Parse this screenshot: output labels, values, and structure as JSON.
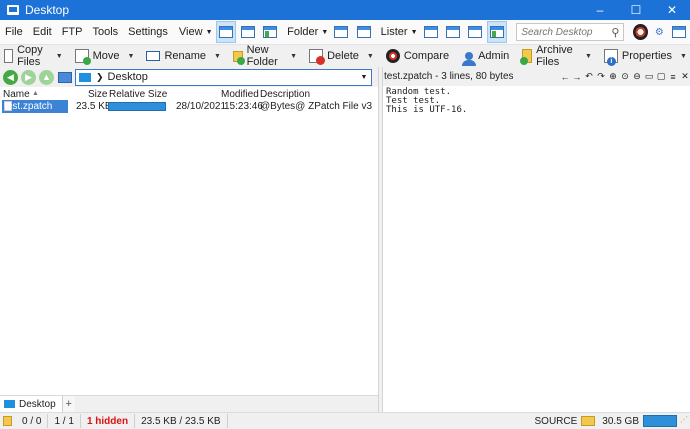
{
  "window": {
    "title": "Desktop",
    "minimize": "–",
    "maximize": "☐",
    "close": "✕"
  },
  "menu": [
    "File",
    "Edit",
    "FTP",
    "Tools",
    "Settings"
  ],
  "view_dropdown": "View",
  "folder_dropdown": "Folder",
  "lister_dropdown": "Lister",
  "search": {
    "placeholder": "Search Desktop"
  },
  "toolbar": {
    "copy": "Copy Files",
    "move": "Move",
    "rename": "Rename",
    "new_folder": "New Folder",
    "delete": "Delete",
    "compare": "Compare",
    "admin": "Admin",
    "archive": "Archive Files",
    "properties": "Properties"
  },
  "left_pane": {
    "path": "Desktop",
    "columns": {
      "name": "Name",
      "size": "Size",
      "relsize": "Relative Size",
      "modified": "Modified",
      "description": "Description"
    },
    "files": [
      {
        "name": "test.zpatch",
        "size": "23.5 KB",
        "relative_fraction": 1.0,
        "date": "28/10/2021",
        "time": "15:23:46",
        "description": "@Bytes@ ZPatch File v3"
      }
    ],
    "tab": "Desktop"
  },
  "preview": {
    "title": "test.zpatch - 3 lines, 80 bytes",
    "lines": "Random test.\nTest test.\nThis is UTF-16."
  },
  "status": {
    "folders": "0 / 0",
    "files": "1 / 1",
    "hidden": "1 hidden",
    "size": "23.5 KB / 23.5 KB",
    "source": "SOURCE",
    "free": "30.5 GB"
  }
}
